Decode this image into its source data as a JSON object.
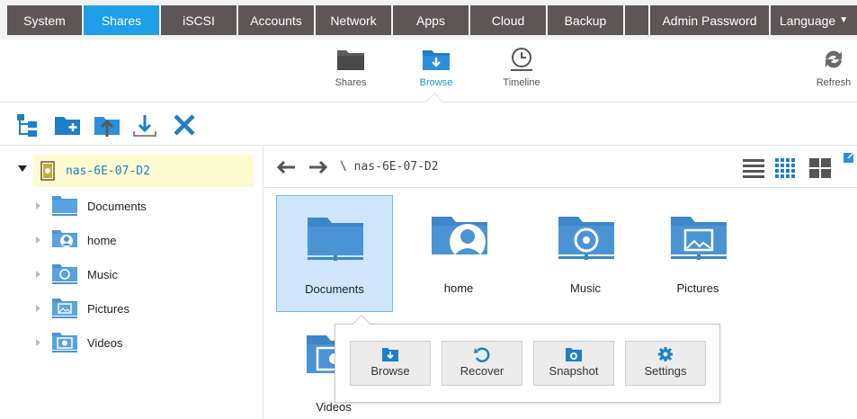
{
  "topnav": {
    "tabs": [
      "System",
      "Shares",
      "iSCSI",
      "Accounts",
      "Network",
      "Apps",
      "Cloud",
      "Backup",
      "",
      "Admin Password",
      "Language"
    ],
    "active": "Shares"
  },
  "subnav": {
    "shares": "Shares",
    "browse": "Browse",
    "timeline": "Timeline",
    "refresh": "Refresh"
  },
  "tree": {
    "root": "nas-6E-07-D2",
    "items": [
      "Documents",
      "home",
      "Music",
      "Pictures",
      "Videos"
    ]
  },
  "main": {
    "path": "\\ nas-6E-07-D2",
    "folders": [
      "Documents",
      "home",
      "Music",
      "Pictures",
      "Videos"
    ],
    "selected": "Documents"
  },
  "popup": {
    "browse": "Browse",
    "recover": "Recover",
    "snapshot": "Snapshot",
    "settings": "Settings"
  },
  "colors": {
    "accent": "#1e9fe8",
    "tab_bg": "#5d5556",
    "folder_blue": "#4a94d6",
    "selection": "#cfe5fb"
  },
  "icons": {
    "toolbar": [
      "tree-view-icon",
      "new-folder-icon",
      "upload-icon",
      "download-icon",
      "delete-icon"
    ],
    "view_modes": [
      "list-view-icon",
      "grid-view-icon",
      "tile-view-icon"
    ]
  }
}
